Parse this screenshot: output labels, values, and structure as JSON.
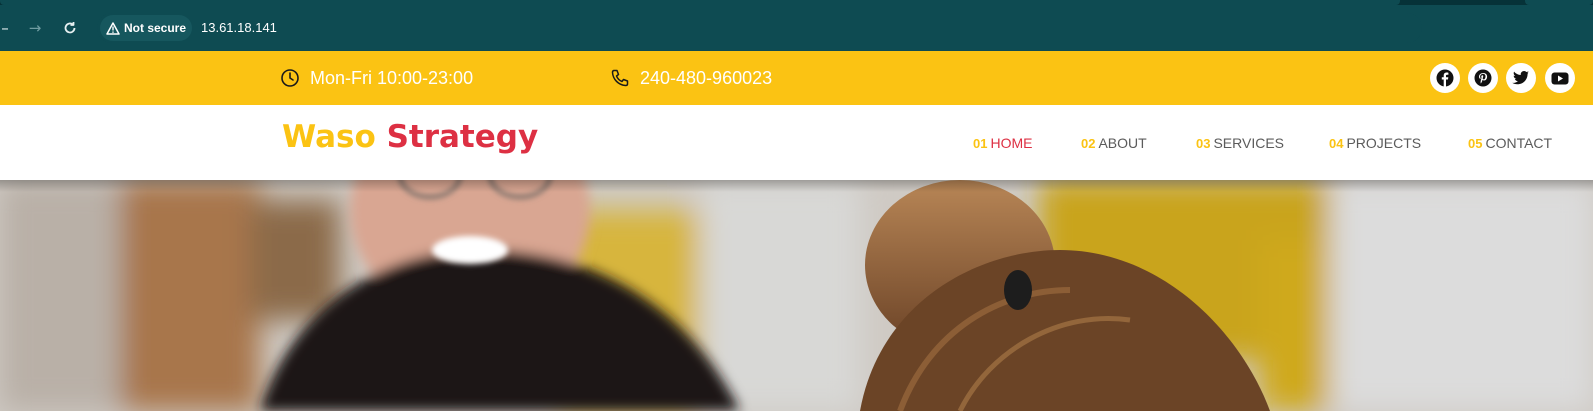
{
  "browser": {
    "security_label": "Not secure",
    "url": "13.61.18.141"
  },
  "topbar": {
    "hours": "Mon-Fri 10:00-23:00",
    "phone": "240-480-960023",
    "social": [
      "facebook-icon",
      "pinterest-icon",
      "twitter-icon",
      "youtube-icon"
    ]
  },
  "logo": {
    "first": "Waso",
    "second": "Strategy"
  },
  "nav": {
    "items": [
      {
        "num": "01",
        "label": "HOME"
      },
      {
        "num": "02",
        "label": "ABOUT"
      },
      {
        "num": "03",
        "label": "SERVICES"
      },
      {
        "num": "04",
        "label": "PROJECTS"
      },
      {
        "num": "05",
        "label": "CONTACT"
      }
    ],
    "active_index": 0
  },
  "colors": {
    "chrome": "#0e4b52",
    "topbar": "#fbc313",
    "accent_yellow": "#fbc313",
    "accent_red": "#dd3043"
  }
}
